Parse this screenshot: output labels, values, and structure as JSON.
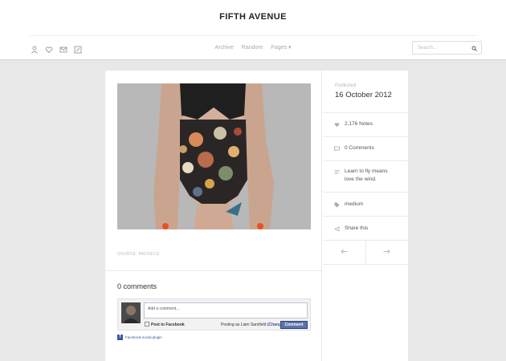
{
  "site": {
    "title": "FIFTH AVENUE"
  },
  "header": {
    "icons": [
      "person-icon",
      "heart-icon",
      "mail-icon",
      "edit-icon"
    ],
    "nav": [
      "Archive",
      "Random",
      "Pages ▾"
    ],
    "search_placeholder": "Search..."
  },
  "post": {
    "source": "SOURCE: 8MCRELD",
    "comments_title": "0 comments"
  },
  "facebook": {
    "input_placeholder": "Add a comment...",
    "post_to": "Post to Facebook",
    "posting_as": "Posting as Liam Sarsfield",
    "change": "(Change)",
    "comment_button": "Comment",
    "plugin": "Facebook social plugin"
  },
  "sidebar": {
    "published_label": "Published",
    "published_date": "16 October 2012",
    "notes": "2,176 Notes",
    "comments": "0 Comments",
    "caption_line1": "Learn to fly means",
    "caption_line2": "love the wind.",
    "tag": "medium",
    "share": "Share this"
  },
  "colors": {
    "background": "#e8e8e8",
    "facebook_blue": "#3b5998",
    "text": "#333333"
  }
}
